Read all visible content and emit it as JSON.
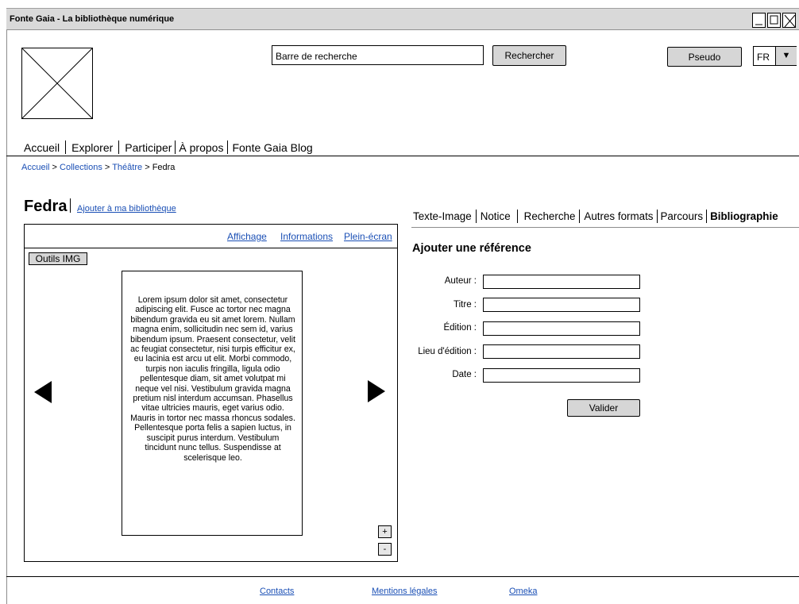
{
  "window": {
    "title": "Fonte Gaia - La bibliothèque numérique"
  },
  "header": {
    "search_placeholder": "Barre de recherche",
    "search_button": "Rechercher",
    "pseudo_button": "Pseudo",
    "language": "FR",
    "language_arrow": "▼"
  },
  "nav": {
    "items": [
      "Accueil",
      "Explorer",
      "Participer",
      "À propos",
      "Fonte Gaia Blog"
    ]
  },
  "breadcrumb": {
    "items": [
      "Accueil",
      "Collections",
      "Théâtre",
      "Fedra"
    ],
    "separator": ">"
  },
  "document": {
    "title": "Fedra",
    "add_to_library": "Ajouter à ma bibliothèque"
  },
  "viewer": {
    "links": [
      "Affichage",
      "Informations",
      "Plein-écran"
    ],
    "tools_button": "Outils IMG",
    "page_text": "Lorem ipsum dolor sit amet, consectetur adipiscing elit. Fusce ac tortor nec magna bibendum gravida eu sit amet lorem. Nullam magna enim, sollicitudin nec sem id, varius bibendum ipsum. Praesent consectetur, velit ac feugiat consectetur, nisi turpis efficitur ex, eu lacinia est arcu ut elit. Morbi commodo, turpis non iaculis fringilla, ligula odio pellentesque diam, sit amet volutpat mi neque vel nisi. Vestibulum gravida magna pretium nisl interdum accumsan. Phasellus vitae ultricies mauris, eget varius odio. Mauris in tortor nec massa rhoncus sodales. Pellentesque porta felis a sapien luctus, in suscipit purus interdum. Vestibulum tincidunt nunc tellus. Suspendisse at scelerisque leo.",
    "zoom_in": "+",
    "zoom_out": "-"
  },
  "tabs": {
    "items": [
      "Texte-Image",
      "Notice",
      "Recherche",
      "Autres formats",
      "Parcours",
      "Bibliographie"
    ],
    "active": "Bibliographie"
  },
  "form": {
    "title": "Ajouter une référence",
    "fields": [
      {
        "label": "Auteur :",
        "value": ""
      },
      {
        "label": "Titre :",
        "value": ""
      },
      {
        "label": "Édition :",
        "value": ""
      },
      {
        "label": "Lieu d'édition :",
        "value": ""
      },
      {
        "label": "Date :",
        "value": ""
      }
    ],
    "submit": "Valider"
  },
  "footer": {
    "links": [
      "Contacts",
      "Mentions légales",
      "Omeka"
    ]
  }
}
